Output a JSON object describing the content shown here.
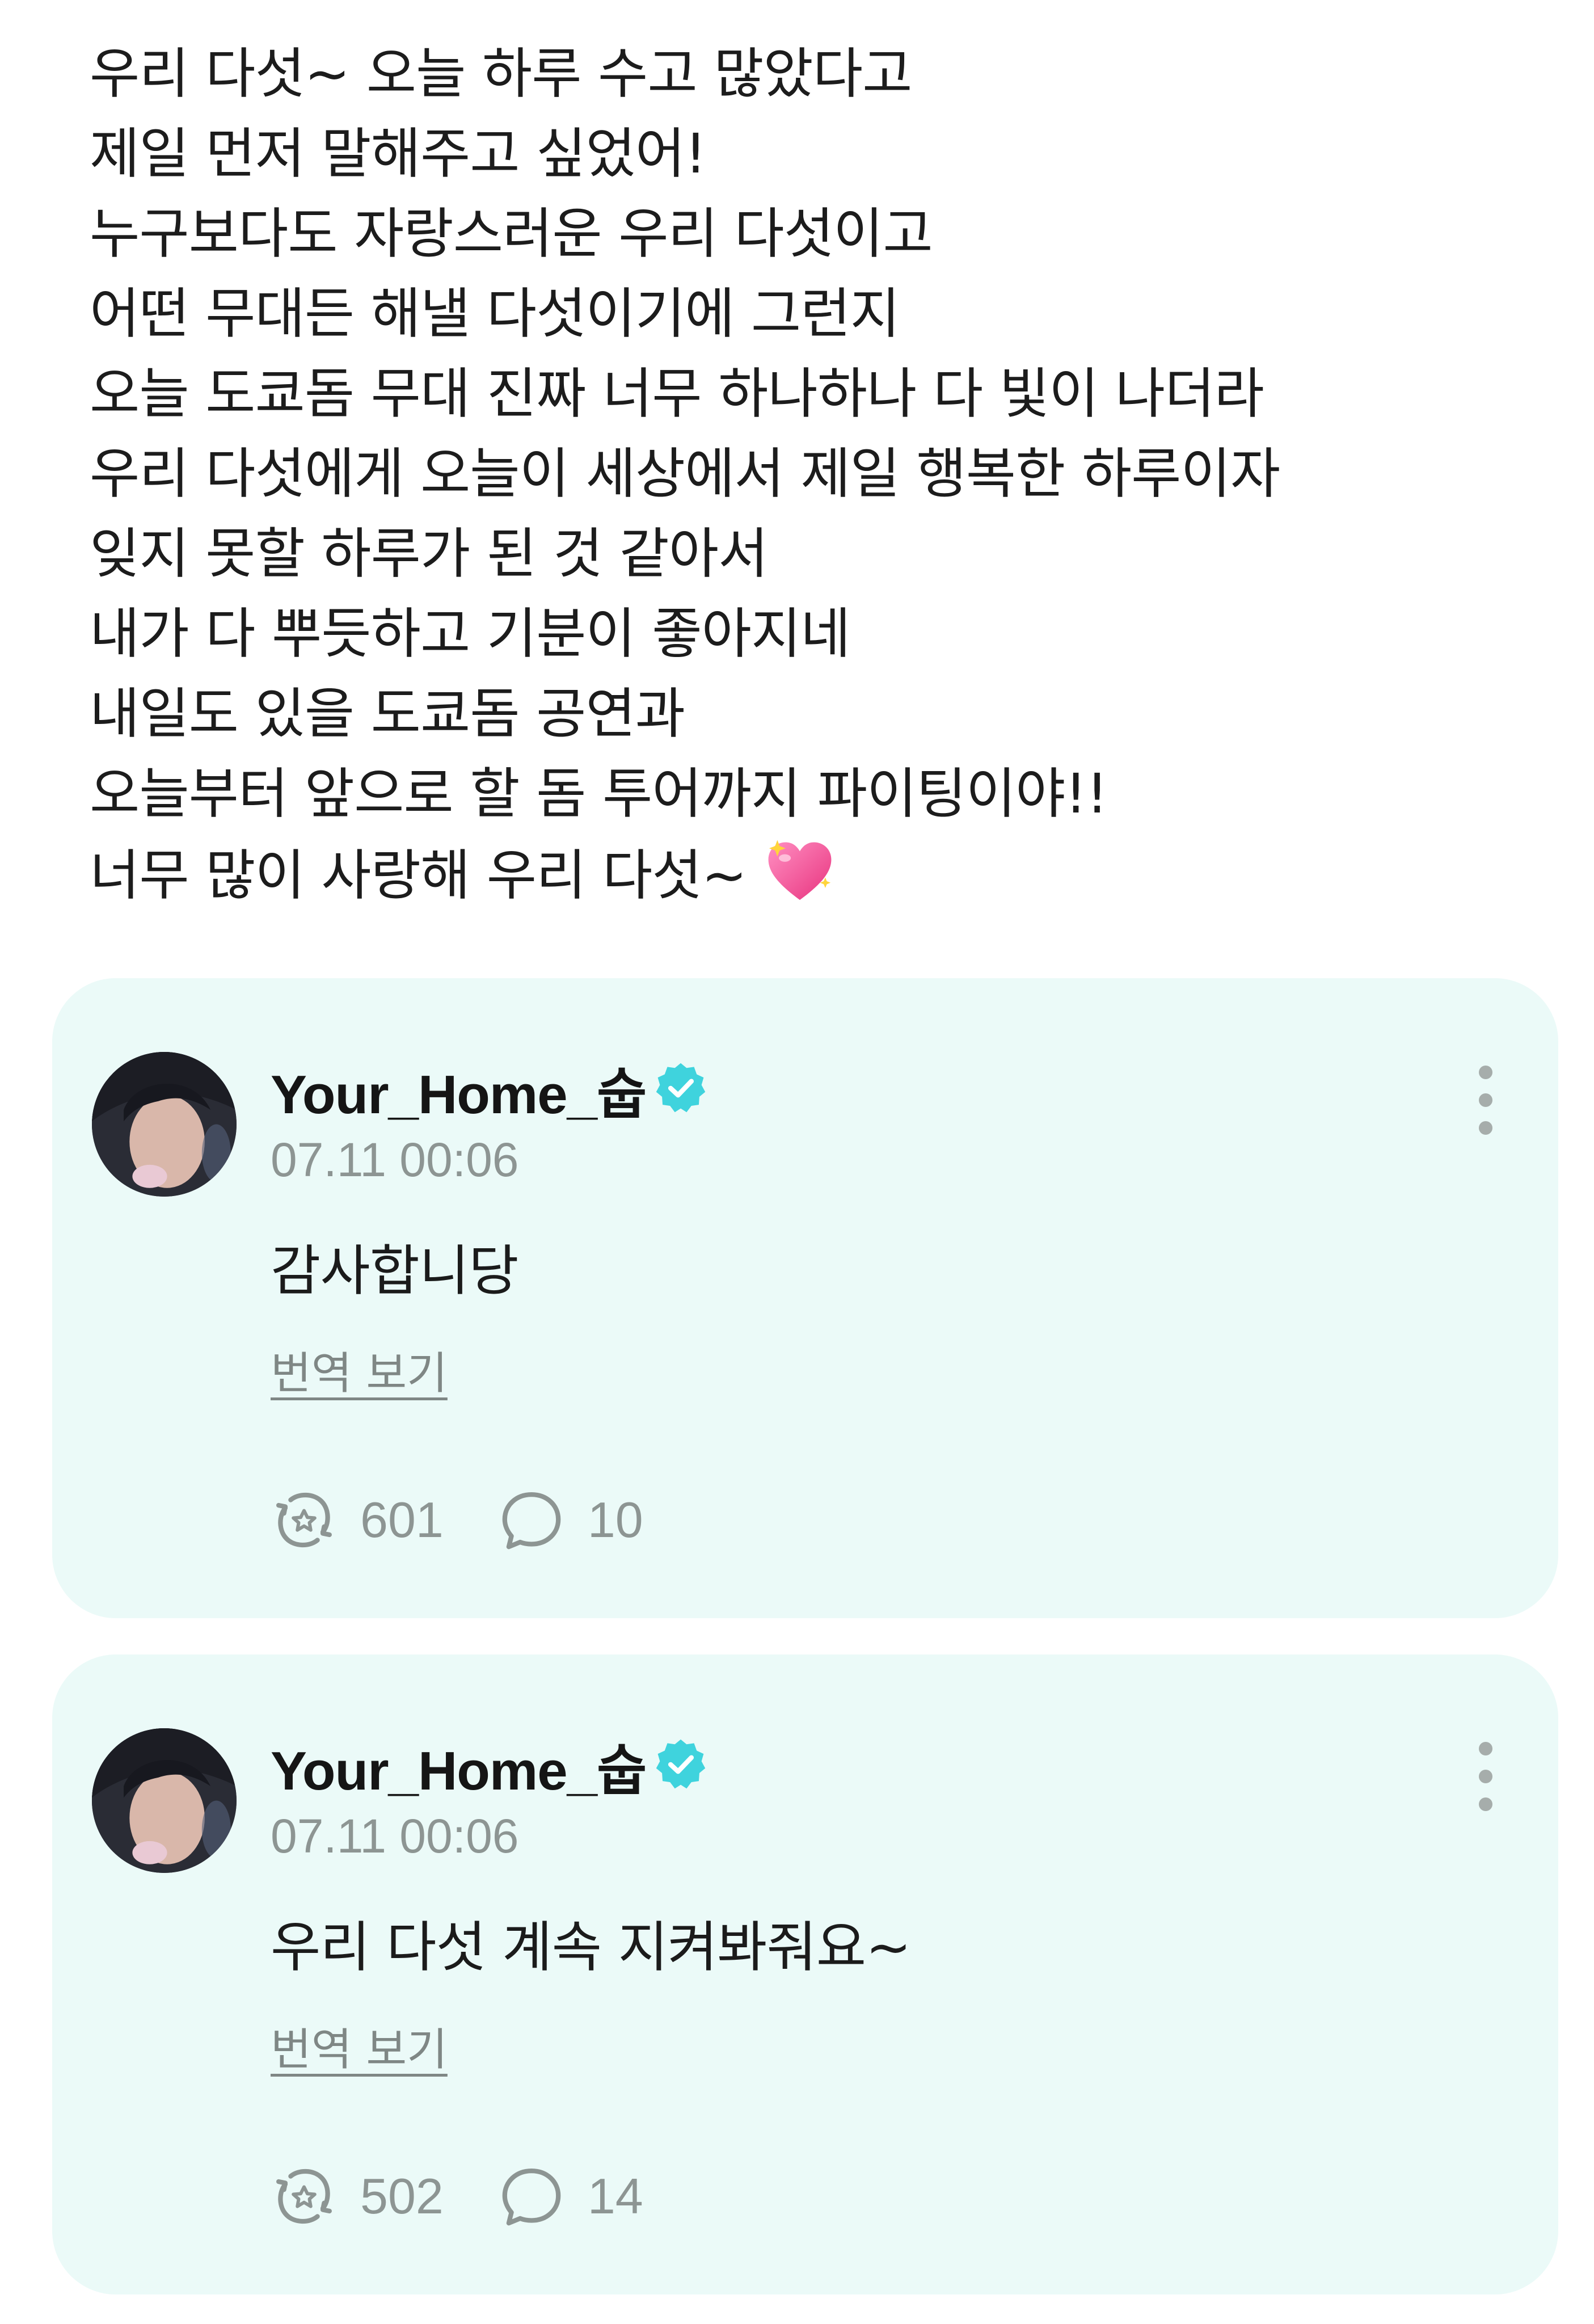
{
  "post": {
    "lines": [
      "우리 다섯~ 오늘 하루 수고 많았다고",
      "제일 먼저 말해주고 싶었어!",
      "누구보다도 자랑스러운 우리 다섯이고",
      "어떤 무대든 해낼 다섯이기에 그런지",
      "오늘 도쿄돔 무대 진짜 너무 하나하나 다 빛이 나더라",
      "우리 다섯에게 오늘이 세상에서 제일 행복한 하루이자",
      "잊지 못할 하루가 된 것 같아서",
      "내가 다 뿌듯하고 기분이 좋아지네",
      "내일도 있을 도쿄돔 공연과",
      "오늘부터 앞으로 할 돔 투어까지 파이팅이야!!",
      "너무 많이 사랑해 우리 다섯~"
    ],
    "emoji": "sparkling-heart"
  },
  "replies": [
    {
      "username": "Your_Home_숩",
      "verified": true,
      "timestamp": "07.11 00:06",
      "text": "감사합니당",
      "translate_label": "번역 보기",
      "repost_count": "601",
      "comment_count": "10"
    },
    {
      "username": "Your_Home_숩",
      "verified": true,
      "timestamp": "07.11 00:06",
      "text": "우리 다섯 계속 지켜봐줘요~",
      "translate_label": "번역 보기",
      "repost_count": "502",
      "comment_count": "14"
    }
  ],
  "colors": {
    "card_background": "#ebfaf8",
    "verified_badge": "#3fd3dd",
    "muted_text": "#8d9593"
  }
}
